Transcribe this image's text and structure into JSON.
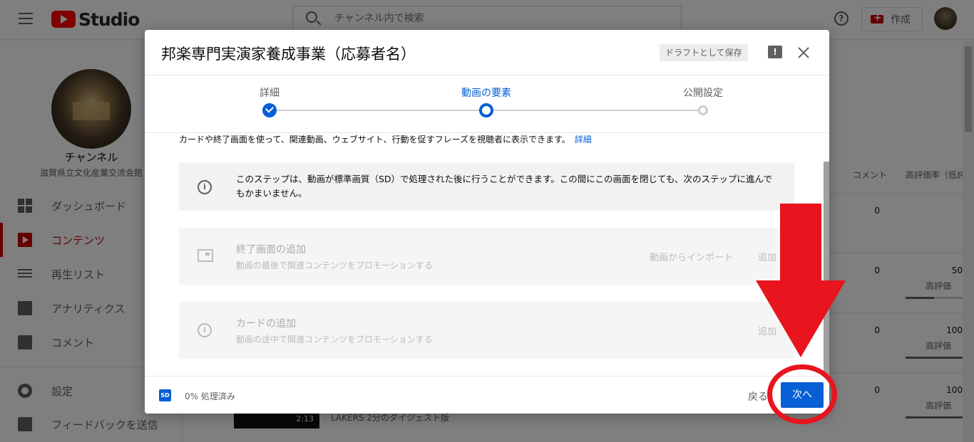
{
  "header": {
    "logo_text": "Studio",
    "search_placeholder": "チャンネル内で検索",
    "help_icon": "?",
    "create_label": "作成"
  },
  "sidebar": {
    "channel_name": "チャンネル",
    "channel_sub": "滋賀県立文化産業交流会館",
    "items": [
      {
        "label": "ダッシュボード",
        "icon": "dashboard-icon"
      },
      {
        "label": "コンテンツ",
        "icon": "content-icon",
        "active": true
      },
      {
        "label": "再生リスト",
        "icon": "playlist-icon"
      },
      {
        "label": "アナリティクス",
        "icon": "analytics-icon"
      },
      {
        "label": "コメント",
        "icon": "comment-icon"
      },
      {
        "label": "設定",
        "icon": "gear-icon"
      },
      {
        "label": "フィードバックを送信",
        "icon": "feedback-icon"
      }
    ]
  },
  "table": {
    "col_comments": "コメント",
    "col_rating": "高評価率（低評",
    "rows": [
      {
        "comments": "0",
        "rating": "",
        "rating_label": ""
      },
      {
        "comments": "0",
        "rating": "50",
        "rating_label": "高評価"
      },
      {
        "comments": "0",
        "rating": "100",
        "rating_label": "高評価"
      },
      {
        "comments": "0",
        "rating": "100",
        "rating_label": "高評価"
      }
    ],
    "thumb_duration": "2:13",
    "thumb_title": "LAKERS 2分のダイジェスト版"
  },
  "dialog": {
    "title": "邦楽専門実演家養成事業（応募者名）",
    "draft_label": "ドラフトとして保存",
    "steps": [
      {
        "label": "詳細",
        "state": "done"
      },
      {
        "label": "動画の要素",
        "state": "current"
      },
      {
        "label": "公開設定",
        "state": "todo"
      }
    ],
    "intro_text": "カードや終了画面を使って、関連動画、ウェブサイト、行動を促すフレーズを視聴者に表示できます。",
    "intro_link": "詳細",
    "info_text": "このステップは、動画が標準画質（SD）で処理された後に行うことができます。この間にこの画面を閉じても、次のステップに進んでもかまいません。",
    "endscreen": {
      "title": "終了画面の追加",
      "subtitle": "動画の最後で関連コンテンツをプロモーションする",
      "import_label": "動画からインポート",
      "add_label": "追加"
    },
    "cards": {
      "title": "カードの追加",
      "subtitle": "動画の途中で関連コンテンツをプロモーションする",
      "add_label": "追加"
    },
    "footer": {
      "sd_badge": "SD",
      "progress_text": "0% 処理済み",
      "back_label": "戻る",
      "next_label": "次へ"
    }
  },
  "colors": {
    "accent": "#065fd4",
    "annotation": "#e8141e",
    "brand": "#ff0000"
  }
}
